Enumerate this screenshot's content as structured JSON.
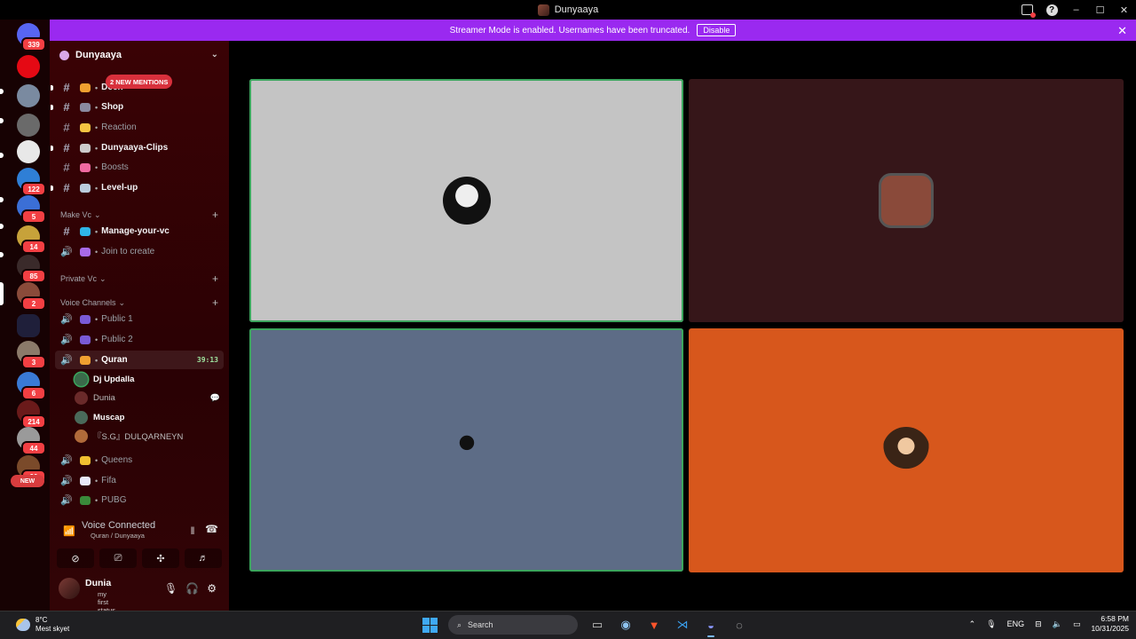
{
  "window": {
    "title": "Dunyaaya"
  },
  "banner": {
    "text": "Streamer Mode is enabled. Usernames have been truncated.",
    "disable_label": "Disable",
    "close_glyph": "✕"
  },
  "rail": {
    "servers": [
      {
        "name": "discord-home",
        "badge": "339",
        "color": "#5865f2"
      },
      {
        "name": "netflix",
        "badge": "",
        "color": "#e50914"
      },
      {
        "name": "server-3",
        "badge": "",
        "color": "#7a8aa0"
      },
      {
        "name": "server-4",
        "badge": "",
        "color": "#6a6a6a"
      },
      {
        "name": "server-5",
        "badge": "",
        "color": "#e8e8e8"
      },
      {
        "name": "server-6",
        "badge": "122",
        "color": "#2f7fd6"
      },
      {
        "name": "server-7",
        "badge": "5",
        "color": "#3b6fd6"
      },
      {
        "name": "server-8",
        "badge": "14",
        "color": "#c7a23a"
      },
      {
        "name": "server-9",
        "badge": "85",
        "color": "#3a2a2a"
      },
      {
        "name": "server-10",
        "badge": "2",
        "color": "#8a4b3a"
      },
      {
        "name": "folder",
        "badge": "",
        "color": "#5865f2"
      },
      {
        "name": "server-12",
        "badge": "3",
        "color": "#8b7a6a"
      },
      {
        "name": "server-13",
        "badge": "6",
        "color": "#3a7ad6"
      },
      {
        "name": "server-14",
        "badge": "214",
        "color": "#6a1a1a"
      },
      {
        "name": "server-15",
        "badge": "44",
        "color": "#9a9a9a"
      },
      {
        "name": "server-16",
        "badge": "20",
        "color": "#7a4a2a"
      }
    ],
    "new_label": "NEW"
  },
  "guild": {
    "name": "Dunyaaya",
    "mentions_label": "2 NEW MENTIONS"
  },
  "channels": [
    {
      "kind": "text",
      "name": "Deen",
      "emoji_color": "#f0a030",
      "bright": true,
      "unread": true
    },
    {
      "kind": "text",
      "name": "Shop",
      "emoji_color": "#8a8aa0",
      "bright": true,
      "unread": true
    },
    {
      "kind": "text",
      "name": "Reaction",
      "emoji_color": "#f5c542",
      "bright": false,
      "unread": false
    },
    {
      "kind": "text",
      "name": "Dunyaaya-Clips",
      "emoji_color": "#ccc",
      "bright": true,
      "unread": true
    },
    {
      "kind": "text",
      "name": "Boosts",
      "emoji_color": "#f06aa0",
      "bright": false,
      "unread": false
    },
    {
      "kind": "text",
      "name": "Level-up",
      "emoji_color": "#bcd",
      "bright": true,
      "unread": true
    }
  ],
  "categories": {
    "make_vc": "Make Vc",
    "private_vc": "Private Vc",
    "voice_channels": "Voice Channels"
  },
  "make_vc_channels": [
    {
      "kind": "text",
      "name": "Manage-your-vc",
      "emoji_color": "#2fb5e8",
      "bright": true
    },
    {
      "kind": "voice",
      "name": "Join to create",
      "emoji_color": "#a86ae8",
      "bright": false
    }
  ],
  "voice_channels": [
    {
      "name": "Public 1",
      "emoji_color": "#7a5ad6"
    },
    {
      "name": "Public 2",
      "emoji_color": "#7a5ad6"
    },
    {
      "name": "Quran",
      "emoji_color": "#f0a030",
      "timer": "39:13"
    }
  ],
  "voice_members": [
    {
      "name": "Dj Updalla",
      "color": "#3a6a4a",
      "bold": true,
      "speaking": true
    },
    {
      "name": "Dunia",
      "color": "#6a2a2a",
      "bold": false,
      "speaking": false,
      "streaming": true
    },
    {
      "name": "Muscap",
      "color": "#4a6a5a",
      "bold": true,
      "speaking": false
    },
    {
      "name": "『S.G』DULQARNEYN",
      "color": "#b06a3a",
      "bold": false,
      "speaking": false
    }
  ],
  "more_voice": [
    {
      "name": "Queens",
      "emoji_color": "#f0c030"
    },
    {
      "name": "Fifa",
      "emoji_color": "#e8e8f8"
    },
    {
      "name": "PUBG",
      "emoji_color": "#3a8a3a"
    }
  ],
  "voice_status": {
    "title": "Voice Connected",
    "sub": "Quran / Dunyaaya"
  },
  "user": {
    "name": "Dunia",
    "status": "my first status"
  },
  "tiles": [
    {
      "label": "tile-1",
      "bg": "#c4c4c4",
      "avatar": "#1f1f1f",
      "speaking": true,
      "shape": "round"
    },
    {
      "label": "tile-2",
      "bg": "#361619",
      "avatar": "#8a4a3a",
      "speaking": false,
      "shape": "square"
    },
    {
      "label": "tile-3",
      "bg": "#5d6c86",
      "avatar": "#2a3548",
      "speaking": true,
      "shape": "round"
    },
    {
      "label": "tile-4",
      "bg": "#d7571c",
      "avatar": "#5a3a22",
      "speaking": false,
      "shape": "round"
    }
  ],
  "taskbar": {
    "temp": "8°C",
    "weather": "Mest skyet",
    "search_placeholder": "Search",
    "lang": "ENG",
    "time": "6:58 PM",
    "date": "10/31/2025"
  }
}
